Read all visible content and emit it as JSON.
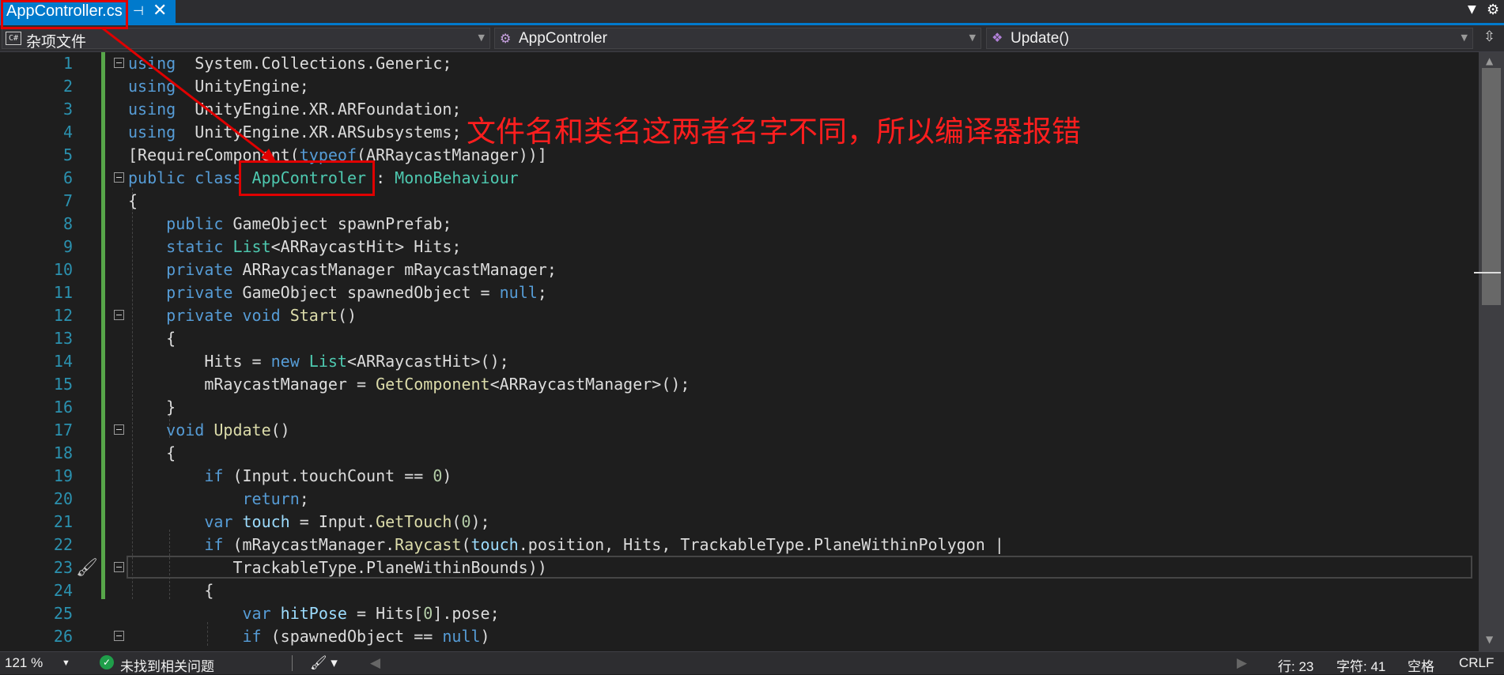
{
  "tab": {
    "title": "AppController.cs",
    "pin_glyph": "⊣",
    "close_glyph": "✕"
  },
  "nav": {
    "project": "杂项文件",
    "class": "AppControler",
    "member": "Update()"
  },
  "code_lines": [
    {
      "n": "1",
      "tokens": [
        [
          "kw",
          "using"
        ],
        [
          "",
          "  System.Collections.Generic;"
        ]
      ]
    },
    {
      "n": "2",
      "tokens": [
        [
          "kw",
          "using"
        ],
        [
          "",
          "  UnityEngine;"
        ]
      ]
    },
    {
      "n": "3",
      "tokens": [
        [
          "kw",
          "using"
        ],
        [
          "",
          "  UnityEngine.XR.ARFoundation;"
        ]
      ]
    },
    {
      "n": "4",
      "tokens": [
        [
          "kw",
          "using"
        ],
        [
          "",
          "  UnityEngine.XR.ARSubsystems;"
        ]
      ]
    },
    {
      "n": "5",
      "tokens": [
        [
          "",
          "[RequireComponent("
        ],
        [
          "kw",
          "typeof"
        ],
        [
          "",
          "(ARRaycastManager))]"
        ]
      ]
    },
    {
      "n": "6",
      "tokens": [
        [
          "kw",
          "public class "
        ],
        [
          "ty",
          "AppControler"
        ],
        [
          "",
          " : "
        ],
        [
          "ty",
          "MonoBehaviour"
        ]
      ]
    },
    {
      "n": "7",
      "tokens": [
        [
          "",
          "{"
        ]
      ]
    },
    {
      "n": "8",
      "tokens": [
        [
          "",
          "    "
        ],
        [
          "kw",
          "public"
        ],
        [
          "",
          " GameObject spawnPrefab;"
        ]
      ]
    },
    {
      "n": "9",
      "tokens": [
        [
          "",
          "    "
        ],
        [
          "kw",
          "static"
        ],
        [
          "",
          " "
        ],
        [
          "ty",
          "List"
        ],
        [
          "",
          "<ARRaycastHit> Hits;"
        ]
      ]
    },
    {
      "n": "10",
      "tokens": [
        [
          "",
          "    "
        ],
        [
          "kw",
          "private"
        ],
        [
          "",
          " ARRaycastManager mRaycastManager;"
        ]
      ]
    },
    {
      "n": "11",
      "tokens": [
        [
          "",
          "    "
        ],
        [
          "kw",
          "private"
        ],
        [
          "",
          " GameObject spawnedObject = "
        ],
        [
          "kw",
          "null"
        ],
        [
          "",
          ";"
        ]
      ]
    },
    {
      "n": "12",
      "tokens": [
        [
          "",
          "    "
        ],
        [
          "kw",
          "private void"
        ],
        [
          "",
          " "
        ],
        [
          "me",
          "Start"
        ],
        [
          "",
          "()"
        ]
      ]
    },
    {
      "n": "13",
      "tokens": [
        [
          "",
          "    {"
        ]
      ]
    },
    {
      "n": "14",
      "tokens": [
        [
          "",
          "        Hits = "
        ],
        [
          "kw",
          "new"
        ],
        [
          "",
          " "
        ],
        [
          "ty",
          "List"
        ],
        [
          "",
          "<ARRaycastHit>();"
        ]
      ]
    },
    {
      "n": "15",
      "tokens": [
        [
          "",
          "        mRaycastManager = "
        ],
        [
          "me",
          "GetComponent"
        ],
        [
          "",
          "<ARRaycastManager>();"
        ]
      ]
    },
    {
      "n": "16",
      "tokens": [
        [
          "",
          "    }"
        ]
      ]
    },
    {
      "n": "17",
      "tokens": [
        [
          "",
          "    "
        ],
        [
          "kw",
          "void"
        ],
        [
          "",
          " "
        ],
        [
          "me",
          "Update"
        ],
        [
          "",
          "()"
        ]
      ]
    },
    {
      "n": "18",
      "tokens": [
        [
          "",
          "    {"
        ]
      ]
    },
    {
      "n": "19",
      "tokens": [
        [
          "",
          "        "
        ],
        [
          "kw",
          "if"
        ],
        [
          "",
          " (Input.touchCount == "
        ],
        [
          "nu",
          "0"
        ],
        [
          "",
          ")"
        ]
      ]
    },
    {
      "n": "20",
      "tokens": [
        [
          "",
          "            "
        ],
        [
          "kw",
          "return"
        ],
        [
          "",
          ";"
        ]
      ]
    },
    {
      "n": "21",
      "tokens": [
        [
          "",
          "        "
        ],
        [
          "kw",
          "var"
        ],
        [
          "",
          " "
        ],
        [
          "vr",
          "touch"
        ],
        [
          "",
          " = Input."
        ],
        [
          "me",
          "GetTouch"
        ],
        [
          "",
          "("
        ],
        [
          "nu",
          "0"
        ],
        [
          "",
          ");"
        ]
      ]
    },
    {
      "n": "22",
      "tokens": [
        [
          "",
          "        "
        ],
        [
          "kw",
          "if"
        ],
        [
          "",
          " (mRaycastManager."
        ],
        [
          "me",
          "Raycast"
        ],
        [
          "",
          "("
        ],
        [
          "vr",
          "touch"
        ],
        [
          "",
          ".position, Hits, TrackableType.PlaneWithinPolygon |"
        ]
      ]
    },
    {
      "n": "23",
      "tokens": [
        [
          "",
          "           TrackableType.PlaneWithinBounds))"
        ]
      ]
    },
    {
      "n": "24",
      "tokens": [
        [
          "",
          "        {"
        ]
      ]
    },
    {
      "n": "25",
      "tokens": [
        [
          "",
          "            "
        ],
        [
          "kw",
          "var"
        ],
        [
          "",
          " "
        ],
        [
          "vr",
          "hitPose"
        ],
        [
          "",
          " = Hits["
        ],
        [
          "nu",
          "0"
        ],
        [
          "",
          "].pose;"
        ]
      ]
    },
    {
      "n": "26",
      "tokens": [
        [
          "",
          "            "
        ],
        [
          "kw",
          "if"
        ],
        [
          "",
          " (spawnedObject == "
        ],
        [
          "kw",
          "null"
        ],
        [
          "",
          ")"
        ]
      ]
    }
  ],
  "fold_lines": [
    "1",
    "6",
    "12",
    "17",
    "23",
    "26"
  ],
  "annotation": "文件名和类名这两者名字不同，所以编译器报错",
  "status": {
    "zoom": "121 %",
    "issues": "未找到相关问题",
    "line": "行: 23",
    "char": "字符: 41",
    "spacing": "空格",
    "eol": "CRLF"
  },
  "colors": {
    "keyword": "#569cd6",
    "type": "#4ec9b0",
    "method": "#dcdcaa",
    "number": "#b5cea8",
    "variable": "#9cdcfe",
    "line_number": "#2b91af",
    "accent": "#007acc",
    "annotation": "#ff1e1e"
  }
}
